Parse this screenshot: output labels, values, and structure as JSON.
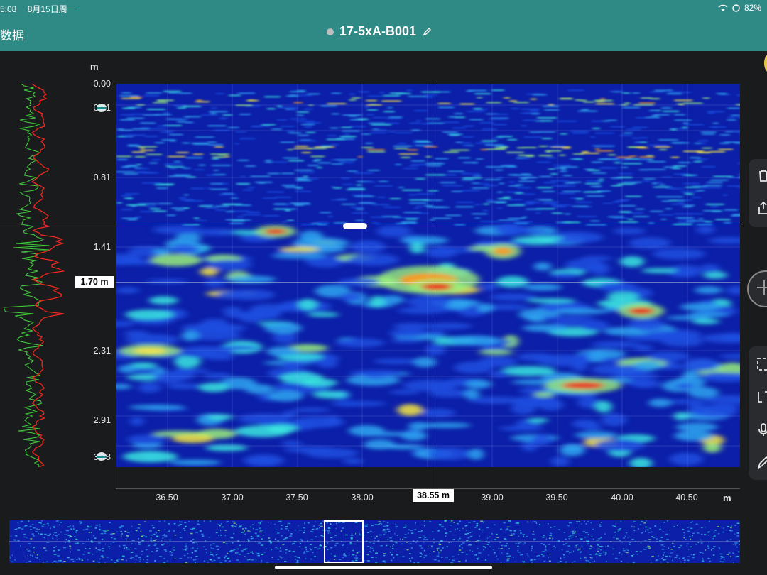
{
  "status_bar": {
    "time": "5:08",
    "date": "8月15日周一",
    "battery": "82%"
  },
  "nav": {
    "back_label": "数据",
    "title": "17-5xA-B001"
  },
  "y_axis": {
    "unit": "m",
    "ticks": [
      "0.00",
      "0.41",
      "0.81",
      "1.41",
      "2.31",
      "2.91",
      "3.38"
    ]
  },
  "x_axis": {
    "unit": "m",
    "ticks": [
      "36.50",
      "37.00",
      "37.50",
      "38.00",
      "39.00",
      "39.50",
      "40.00",
      "40.50"
    ]
  },
  "cursor": {
    "depth_label": "1.70 m",
    "position_label": "38.55 m"
  },
  "icons": [
    "wifi-icon",
    "battery-icon",
    "edit-icon",
    "trash-icon",
    "share-icon",
    "zoom-icon",
    "select-icon",
    "compare-icon",
    "mic-icon",
    "pen-icon"
  ],
  "colors": {
    "header": "#2f8a86",
    "trace_green": "#43d13e",
    "trace_red": "#f0281e",
    "radar_bg": "#0c1fa8"
  }
}
